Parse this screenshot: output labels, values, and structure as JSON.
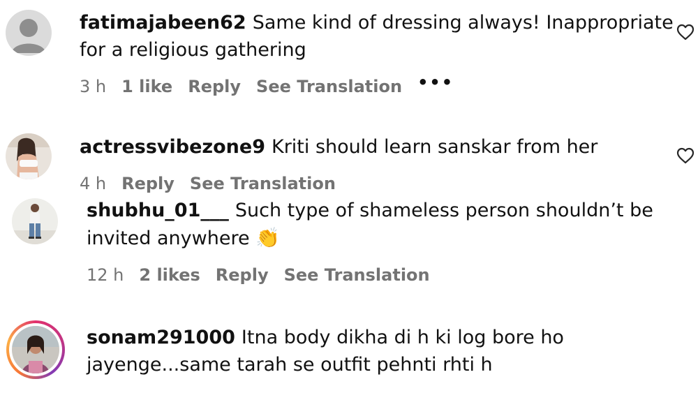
{
  "comments": [
    {
      "username": "fatimajabeen62",
      "text_line1": "Same kind of dressing always! Inappropriate",
      "text_line2": "for a religious gathering",
      "time": "3 h",
      "likes": "1 like",
      "reply": "Reply",
      "translate": "See Translation",
      "more": "•••"
    },
    {
      "username": "actressvibezone9",
      "text_line1": "Kriti should learn sanskar from her",
      "time": "4 h",
      "reply": "Reply",
      "translate": "See Translation"
    },
    {
      "username": "shubhu_01___",
      "text_line1": "Such type of shameless person shouldn’t be",
      "text_line2": "invited anywhere",
      "emoji": "👏",
      "time": "12 h",
      "likes": "2 likes",
      "reply": "Reply",
      "translate": "See Translation"
    },
    {
      "username": "sonam291000",
      "text_line1": "Itna body dikha di h ki log bore ho",
      "text_line2": "jayenge...same tarah se outfit pehnti rhti h"
    }
  ],
  "icons": {
    "heart": "heart-outline-icon",
    "more": "more-horizontal-icon",
    "emoji": "clapping-hands-emoji"
  },
  "colors": {
    "text": "#111111",
    "meta": "#737373",
    "story_ring": "#e1306c"
  }
}
